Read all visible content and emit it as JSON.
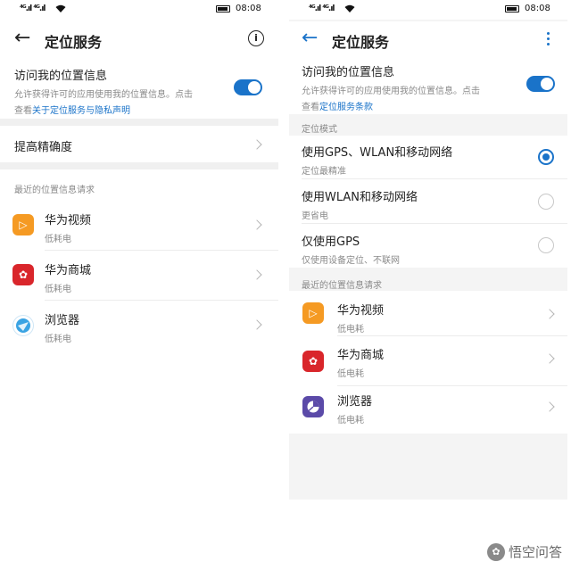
{
  "status": {
    "signal": "⁴ᴳ.ıl ⁴ᴳ.ıl",
    "time": "08:08"
  },
  "left": {
    "title": "定位服务",
    "access": {
      "label": "访问我的位置信息",
      "desc_1": "允许获得许可的应用使用我的位置信息。点击",
      "desc_2_prefix": "查看",
      "desc_link": "关于定位服务与隐私声明"
    },
    "accuracy": "提高精确度",
    "recent_header": "最近的位置信息请求",
    "apps": [
      {
        "name": "华为视频",
        "usage": "低耗电"
      },
      {
        "name": "华为商城",
        "usage": "低耗电"
      },
      {
        "name": "浏览器",
        "usage": "低耗电"
      }
    ]
  },
  "right": {
    "title": "定位服务",
    "access": {
      "label": "访问我的位置信息",
      "desc_1": "允许获得许可的应用使用我的位置信息。点击",
      "desc_2_prefix": "查看",
      "desc_link": "定位服务条款"
    },
    "mode_header": "定位模式",
    "modes": [
      {
        "label": "使用GPS、WLAN和移动网络",
        "desc": "定位最精准",
        "selected": true
      },
      {
        "label": "使用WLAN和移动网络",
        "desc": "更省电",
        "selected": false
      },
      {
        "label": "仅使用GPS",
        "desc": "仅使用设备定位、不联网",
        "selected": false
      }
    ],
    "recent_header": "最近的位置信息请求",
    "apps": [
      {
        "name": "华为视频",
        "usage": "低电耗"
      },
      {
        "name": "华为商城",
        "usage": "低电耗"
      },
      {
        "name": "浏览器",
        "usage": "低电耗"
      }
    ]
  },
  "watermark": "悟空问答",
  "colors": {
    "accent": "#1a73c9",
    "video_icon": "#f59a23",
    "mall_icon": "#d9262b",
    "browser_left": "#3aa3e3",
    "browser_right": "#5b4aa8"
  }
}
